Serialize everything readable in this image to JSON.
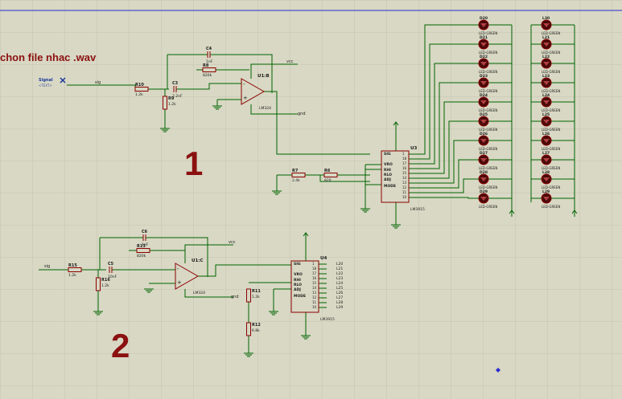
{
  "canvas": {
    "background": "#d8d8c4",
    "grid_color": "#c4c4b0",
    "wire_color": "#006400",
    "part_color": "#8b0000",
    "border_color": "#2b2bcf"
  },
  "note": "chon file nhac .wav",
  "section_labels": [
    "1",
    "2"
  ],
  "generator": {
    "label": "Signal"
  },
  "net_labels": {
    "in": "sig",
    "vcc": "vcc",
    "gnd": "gnd",
    "out": "out"
  },
  "stage1": {
    "opamp": "U1:B",
    "opamp_type": "LM324",
    "resistors": [
      {
        "ref": "R10",
        "value": "1.2k"
      },
      {
        "ref": "R9",
        "value": "1.2k"
      },
      {
        "ref": "R8",
        "value": "820k"
      },
      {
        "ref": "R7",
        "value": "2.4k"
      },
      {
        "ref": "R6",
        "value": "820"
      }
    ],
    "capacitors": [
      {
        "ref": "C3",
        "value": "2.2nF"
      },
      {
        "ref": "C4",
        "value": "1nF"
      }
    ],
    "driver": "U3",
    "driver_type": "LM3915"
  },
  "stage2": {
    "opamp": "U1:C",
    "opamp_type": "LM324",
    "resistors": [
      {
        "ref": "R15",
        "value": "1.2k"
      },
      {
        "ref": "R16",
        "value": "1.2k"
      },
      {
        "ref": "R13",
        "value": "820k"
      },
      {
        "ref": "R11",
        "value": "1.2k"
      },
      {
        "ref": "R12",
        "value": "6.8k"
      }
    ],
    "capacitors": [
      {
        "ref": "C5",
        "value": "10nF"
      },
      {
        "ref": "C6",
        "value": "1nF"
      }
    ],
    "driver": "U4",
    "driver_type": "LM3915"
  },
  "ic_pins": [
    "SIG",
    "VRO",
    "RHI",
    "RLO",
    "ADJ",
    "MODE"
  ],
  "ic_outputs": [
    "1",
    "18",
    "17",
    "16",
    "15",
    "14",
    "13",
    "12",
    "11",
    "10"
  ],
  "led_type": "LED-GREEN",
  "text_placeholder": "<TEXT>",
  "leds_left": [
    "D20",
    "D21",
    "D22",
    "D23",
    "D24",
    "D25",
    "D26",
    "D27",
    "D28",
    "D29"
  ],
  "leds_right": [
    "L30",
    "L21",
    "L22",
    "L23",
    "L24",
    "L25",
    "L26",
    "L27",
    "L28",
    "L29"
  ],
  "u4_outputs": [
    "L20",
    "L21",
    "L22",
    "L23",
    "L24",
    "L25",
    "L26",
    "L27",
    "L28",
    "L29"
  ]
}
